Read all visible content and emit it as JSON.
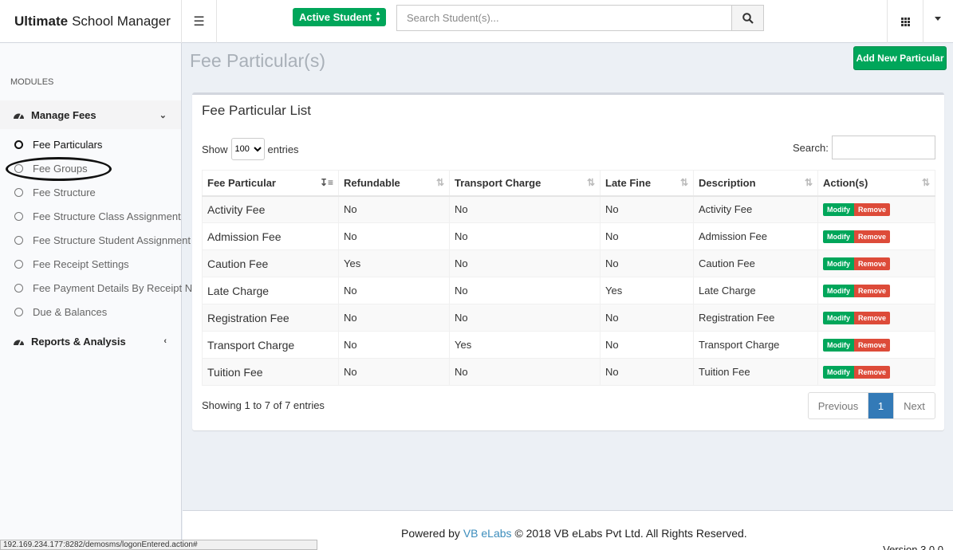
{
  "header": {
    "logo_bold": "Ultimate",
    "logo_rest": "School Manager",
    "active_student_label": "Active Student",
    "search_placeholder": "Search Student(s)..."
  },
  "sidebar": {
    "modules_label": "MODULES",
    "manage_fees": "Manage Fees",
    "items": [
      {
        "label": "Fee Particulars"
      },
      {
        "label": "Fee Groups"
      },
      {
        "label": "Fee Structure"
      },
      {
        "label": "Fee Structure Class Assignment"
      },
      {
        "label": "Fee Structure Student Assignment"
      },
      {
        "label": "Fee Receipt Settings"
      },
      {
        "label": "Fee Payment Details By Receipt No."
      },
      {
        "label": "Due & Balances"
      }
    ],
    "reports": "Reports & Analysis"
  },
  "main": {
    "page_title": "Fee Particular(s)",
    "add_button": "Add New Particular",
    "box_title": "Fee Particular List",
    "show_label": "Show",
    "entries_value": "100",
    "entries_label": "entries",
    "search_label": "Search:",
    "columns": [
      "Fee Particular",
      "Refundable",
      "Transport Charge",
      "Late Fine",
      "Description",
      "Action(s)"
    ],
    "rows": [
      {
        "particular": "Activity Fee",
        "refundable": "No",
        "transport": "No",
        "late_fine": "No",
        "description": "Activity Fee"
      },
      {
        "particular": "Admission Fee",
        "refundable": "No",
        "transport": "No",
        "late_fine": "No",
        "description": "Admission Fee"
      },
      {
        "particular": "Caution Fee",
        "refundable": "Yes",
        "transport": "No",
        "late_fine": "No",
        "description": "Caution Fee"
      },
      {
        "particular": "Late Charge",
        "refundable": "No",
        "transport": "No",
        "late_fine": "Yes",
        "description": "Late Charge"
      },
      {
        "particular": "Registration Fee",
        "refundable": "No",
        "transport": "No",
        "late_fine": "No",
        "description": "Registration Fee"
      },
      {
        "particular": "Transport Charge",
        "refundable": "No",
        "transport": "Yes",
        "late_fine": "No",
        "description": "Transport Charge"
      },
      {
        "particular": "Tuition Fee",
        "refundable": "No",
        "transport": "No",
        "late_fine": "No",
        "description": "Tuition Fee"
      }
    ],
    "modify_label": "Modify",
    "remove_label": "Remove",
    "info": "Showing 1 to 7 of 7 entries",
    "pager": {
      "prev": "Previous",
      "current": "1",
      "next": "Next"
    }
  },
  "footer": {
    "powered_by": "Powered by",
    "link": "VB eLabs",
    "copyright": "© 2018 VB eLabs Pvt Ltd. All Rights Reserved.",
    "version": "Version 3.0.0"
  },
  "status_url": "192.169.234.177:8282/demosms/logonEntered.action#",
  "colors": {
    "green": "#00a65a",
    "red": "#dd4b39",
    "blue": "#337ab7",
    "link": "#3c8dbc"
  }
}
